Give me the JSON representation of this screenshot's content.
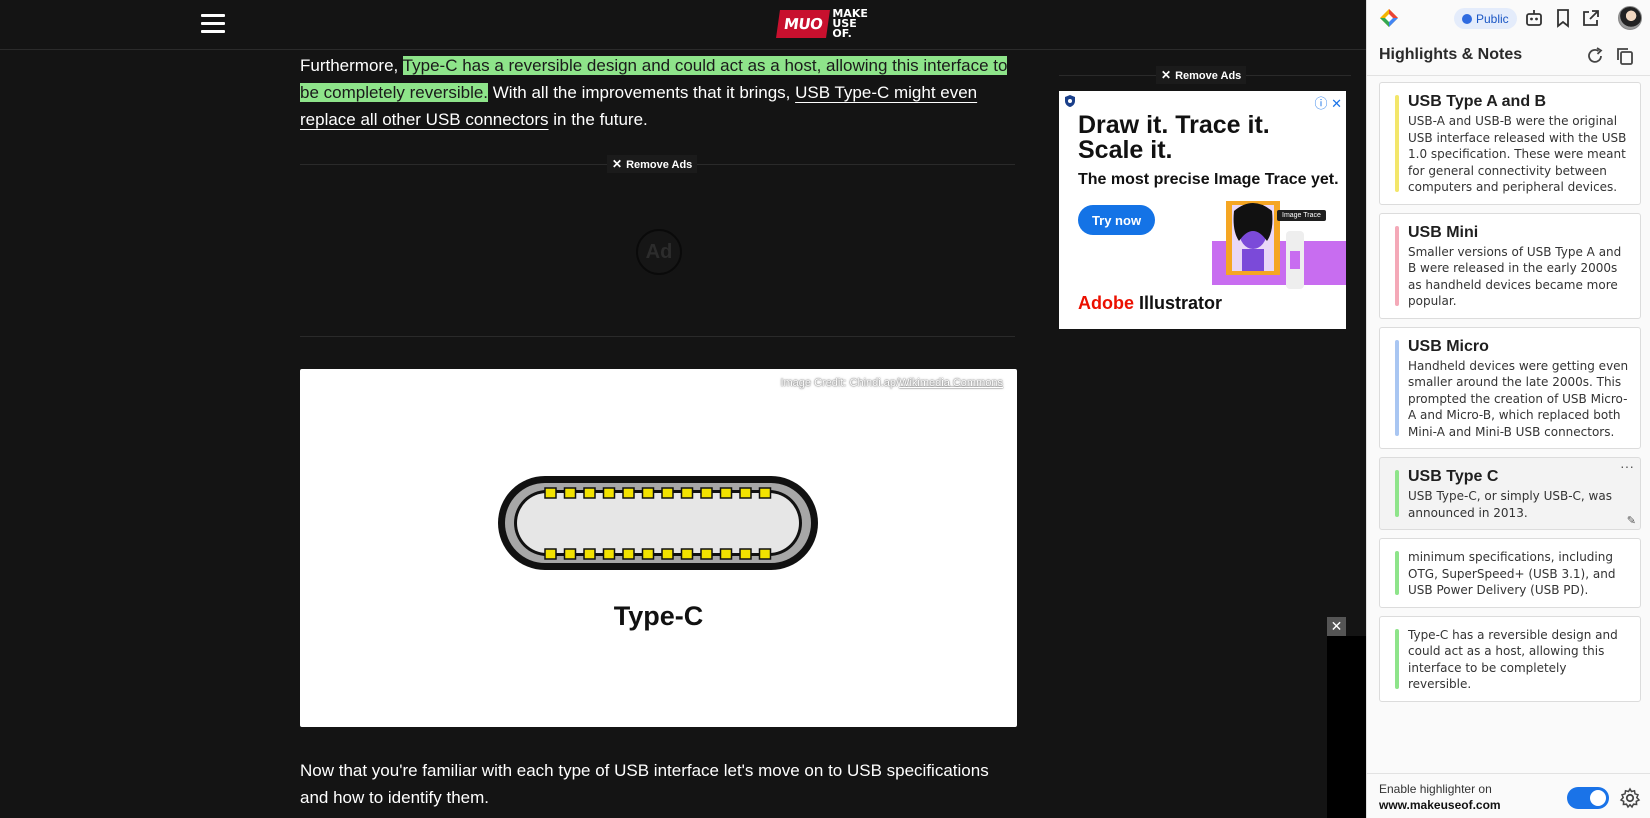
{
  "header": {
    "logo_mark": "MUO",
    "logo_line1": "MAKE",
    "logo_line2": "USE",
    "logo_line3": "OF."
  },
  "article": {
    "p1_before": "Furthermore, ",
    "p1_highlight": "Type-C has a reversible design and could act as a host, allowing this interface to be completely reversible.",
    "p1_middle": " With all the improvements that it brings, ",
    "p1_link": "USB Type-C might even replace all other USB connectors",
    "p1_after": " in the future.",
    "remove_ads": "Remove Ads",
    "ad_placeholder": "Ad",
    "figure_credit_prefix": "Image Credit: Chindi.ap/",
    "figure_credit_link": "Wikimedia Commons",
    "figure_caption": "Type-C",
    "p2": "Now that you're familiar with each type of USB interface let's move on to USB specifications and how to identify them."
  },
  "side_ad": {
    "remove_ads": "Remove Ads",
    "headline_line1": "Draw it. Trace it.",
    "headline_line2": "Scale it.",
    "subhead": "The most precise Image Trace yet.",
    "cta": "Try now",
    "trace_tag": "Image Trace",
    "brand_red": "Adobe",
    "brand_rest": " Illustrator",
    "info": "ⓘ ✕"
  },
  "video": {
    "close": "✕"
  },
  "panel": {
    "visibility": "Public",
    "title": "Highlights & Notes",
    "notes": [
      {
        "title": "USB Type A and B",
        "body": "USB-A and USB-B were the original USB interface released with the USB 1.0 specification. These were meant for general connectivity between computers and peripheral devices.",
        "color": "#f3e66a"
      },
      {
        "title": "USB Mini",
        "body": "Smaller versions of USB Type A and B were released in the early 2000s as handheld devices became more popular.",
        "color": "#f4a9b8"
      },
      {
        "title": "USB Micro",
        "body": "Handheld devices were getting even smaller around the late 2000s. This prompted the creation of USB Micro-A and Micro-B, which replaced both Mini-A and Mini-B USB connectors.",
        "color": "#a9c6f2"
      },
      {
        "title": "USB Type C",
        "body": "USB Type-C, or simply USB-C, was announced in 2013.",
        "color": "#8ee48a",
        "more": "···",
        "edit": "✎"
      },
      {
        "title": "",
        "body": "minimum specifications, including OTG, SuperSpeed+ (USB 3.1), and USB Power Delivery (USB PD).",
        "color": "#8ee48a"
      },
      {
        "title": "",
        "body": "Type-C has a reversible design and could act as a host, allowing this interface to be completely reversible.",
        "color": "#8ee48a"
      }
    ],
    "footer_label": "Enable highlighter on",
    "footer_site": "www.makeuseof.com",
    "toggle_on": true
  },
  "colors": {
    "highlight_green": "#8ee48a",
    "accent_blue": "#1a73e8",
    "brand_red": "#c8102e"
  }
}
